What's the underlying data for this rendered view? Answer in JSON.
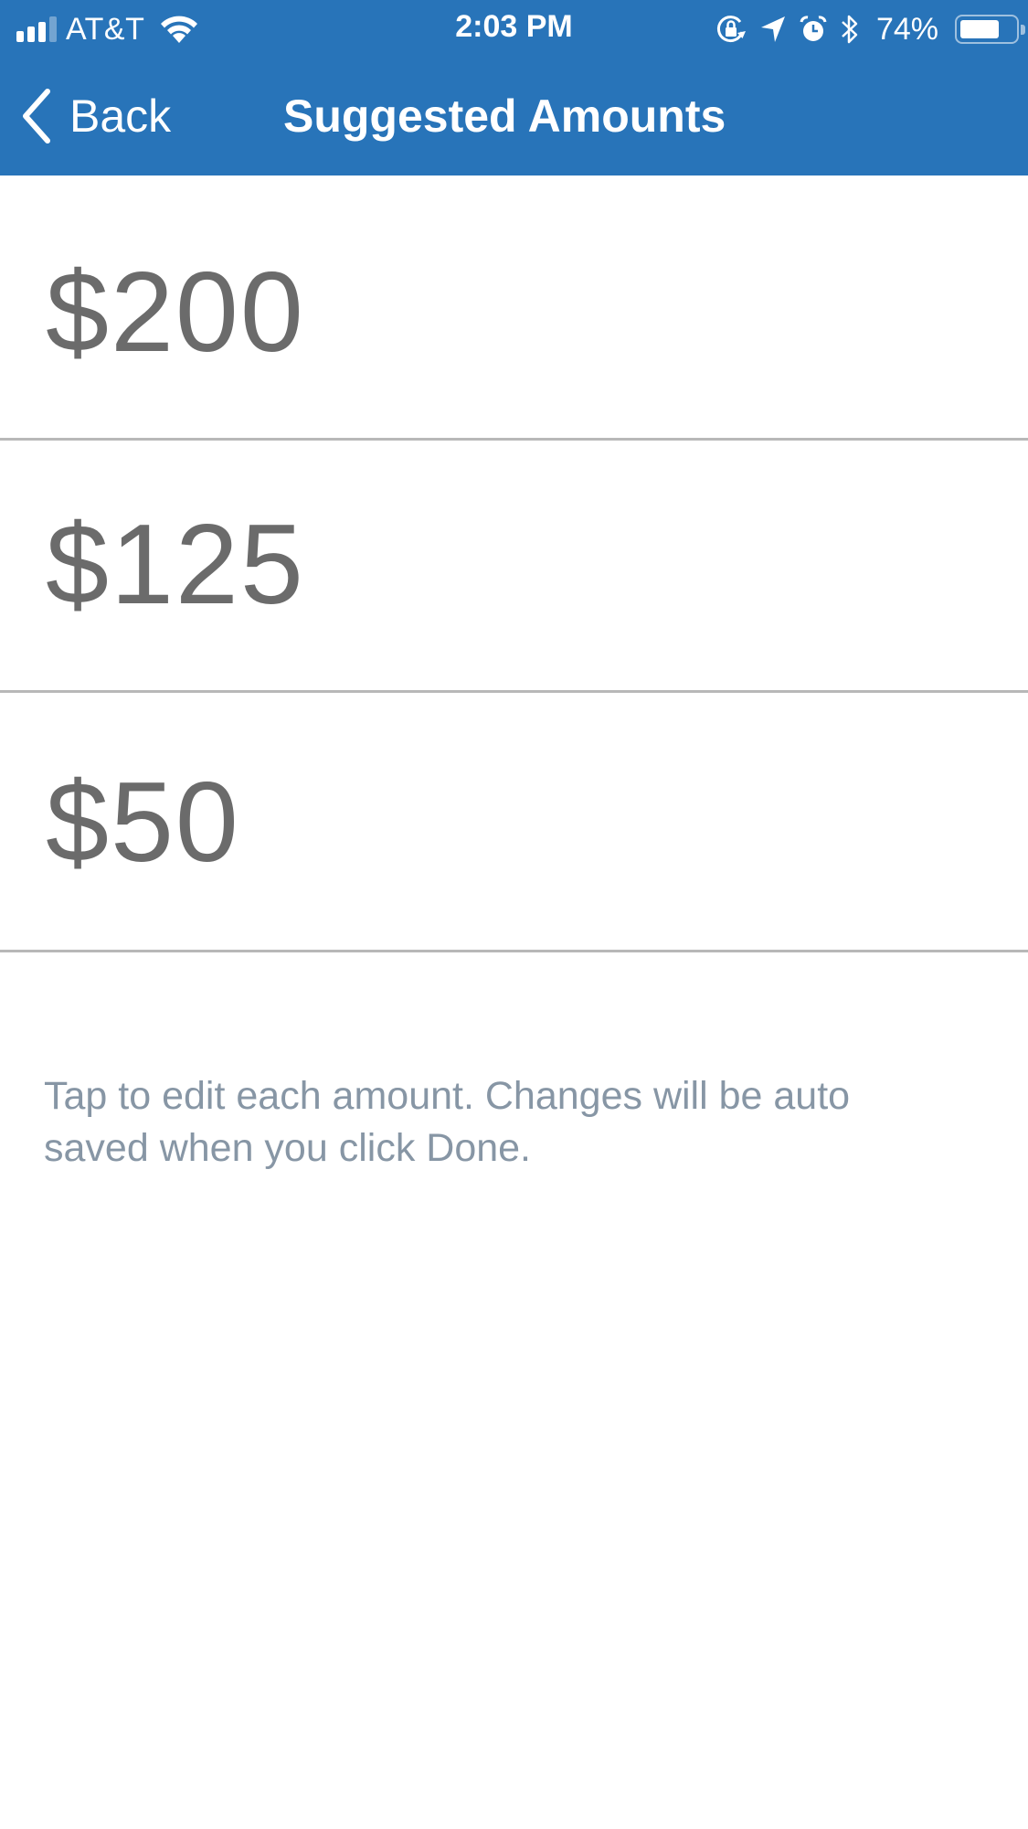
{
  "status_bar": {
    "carrier": "AT&T",
    "time": "2:03 PM",
    "battery_percent_label": "74%",
    "battery_level": 0.74,
    "signal_bars_filled": 3,
    "signal_bars_total": 4,
    "icons": [
      "signal-icon",
      "wifi-icon",
      "orientation-lock-icon",
      "location-icon",
      "alarm-icon",
      "bluetooth-icon",
      "battery-icon"
    ]
  },
  "nav": {
    "back_label": "Back",
    "title": "Suggested Amounts"
  },
  "amounts": [
    {
      "value": "$200"
    },
    {
      "value": "$125"
    },
    {
      "value": "$50"
    }
  ],
  "footnote": "Tap to edit each amount. Changes will be auto saved when you click Done.",
  "colors": {
    "header_bg": "#2874b9",
    "amount_text": "#6b6b6b",
    "divider": "#b8b8b8",
    "footnote_text": "#8796a5"
  }
}
